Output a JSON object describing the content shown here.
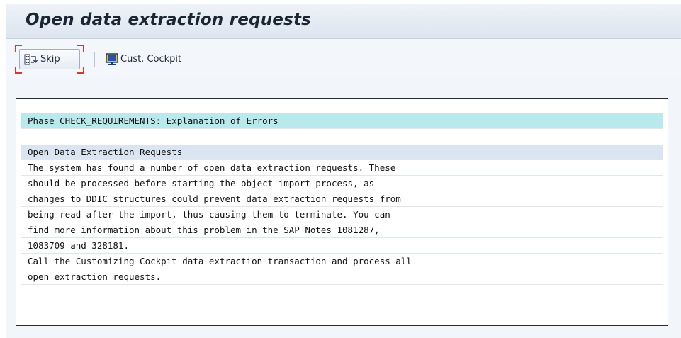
{
  "window": {
    "title": "Open data extraction requests"
  },
  "toolbar": {
    "skip_label": "Skip",
    "cockpit_label": "Cust. Cockpit"
  },
  "panel": {
    "header": "Phase CHECK_REQUIREMENTS: Explanation of Errors",
    "section_title": "Open Data Extraction Requests",
    "lines": [
      "The system has found a number of open data extraction requests. These",
      "should be processed before starting the object import process, as",
      "changes to DDIC structures could prevent data extraction requests from",
      "being read after the import, thus causing them to terminate. You can",
      "find more information about this problem in the SAP Notes 1081287,",
      "1083709 and 328181.",
      "Call the Customizing Cockpit data extraction transaction and process all",
      "open extraction requests."
    ]
  },
  "colors": {
    "header_bg": "#b9e8ed",
    "section_bg": "#dbe5f1",
    "focus": "#e0352b"
  },
  "icons": {
    "skip": "skip-icon",
    "cockpit": "cockpit-monitor-icon"
  }
}
